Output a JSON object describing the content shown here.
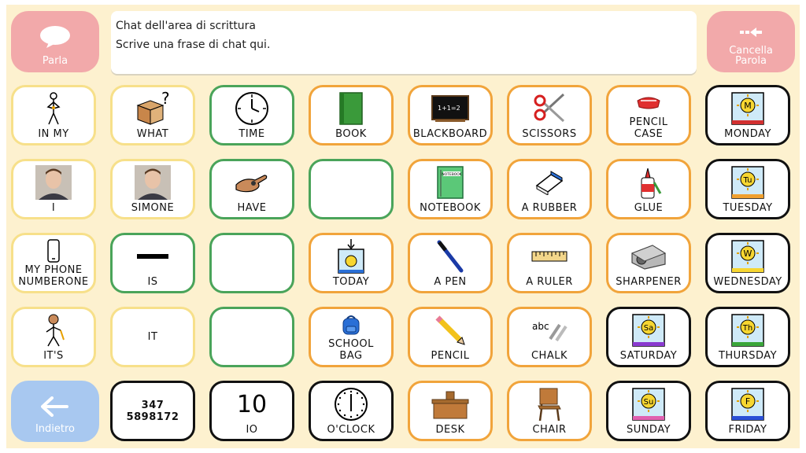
{
  "buttons": {
    "speak": "Parla",
    "clear": "Cancella\nParola",
    "back": "Indietro"
  },
  "chat": {
    "line1": "Chat dell'area di scrittura",
    "line2": "Scrive una frase di chat qui."
  },
  "tiles": {
    "r1": [
      "IN MY",
      "WHAT",
      "TIME",
      "BOOK",
      "BLACKBOARD",
      "SCISSORS",
      "PENCIL\nCASE",
      "MONDAY"
    ],
    "r2": [
      "I",
      "SIMONE",
      "HAVE",
      "",
      "NOTEBOOK",
      "A RUBBER",
      "GLUE",
      "TUESDAY"
    ],
    "r3": [
      "MY  PHONE\nNUMBERONE",
      "IS",
      "",
      "TODAY",
      "A PEN",
      "A RULER",
      "SHARPENER",
      "WEDNESDAY"
    ],
    "r4": [
      "IT'S",
      "IT",
      "",
      "SCHOOL\nBAG",
      "PENCIL",
      "CHALK",
      "SATURDAY",
      "THURSDAY"
    ],
    "r5": [
      "347  5898172",
      "IO",
      "O'CLOCK",
      "DESK",
      "CHAIR",
      "SUNDAY",
      "FRIDAY"
    ]
  },
  "symbols": {
    "ten": "10",
    "abc": "abc",
    "blackboard_text": "1+1=2",
    "notebook_text": "NOTEBOOK",
    "day_letters": [
      "M",
      "Tu",
      "W",
      "Sa",
      "Th",
      "Su",
      "F"
    ]
  },
  "colors": {
    "background": "#fdf1cf",
    "speak_button": "#f2a9aa",
    "back_button": "#a8c8f0",
    "yellow_border": "#f7e08a",
    "green_border": "#4aa45a",
    "orange_border": "#f1a43b",
    "black_border": "#111111"
  }
}
